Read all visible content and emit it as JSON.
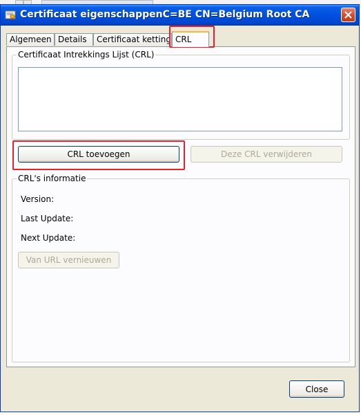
{
  "window": {
    "title": "Certificaat eigenschappenC=BE CN=Belgium Root CA",
    "icon": "certificate-icon",
    "close_icon": "close-icon"
  },
  "tabs": [
    {
      "label": "Algemeen"
    },
    {
      "label": "Details"
    },
    {
      "label": "Certificaat ketting"
    },
    {
      "label": "CRL",
      "active": true
    }
  ],
  "crl_list": {
    "legend": "Certificaat Intrekkings Lijst (CRL)",
    "items": []
  },
  "buttons": {
    "add": "CRL toevoegen",
    "remove": "Deze CRL verwijderen",
    "renew": "Van URL vernieuwen",
    "close": "Close"
  },
  "crl_info": {
    "legend": "CRL's informatie",
    "version_label": "Version:",
    "last_update_label": "Last Update:",
    "next_update_label": "Next Update:"
  },
  "colors": {
    "titlebar": "#0050e0",
    "highlight": "#e8202c",
    "dialog_bg": "#ece9d8"
  }
}
